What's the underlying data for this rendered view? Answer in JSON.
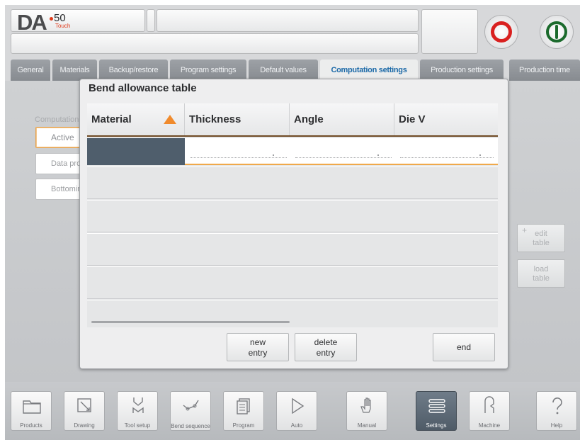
{
  "header": {
    "logo_text": "DA",
    "logo_model": "50",
    "logo_sub": "Touch"
  },
  "tabs": [
    {
      "label": "General"
    },
    {
      "label": "Materials"
    },
    {
      "label": "Backup/restore"
    },
    {
      "label": "Program settings"
    },
    {
      "label": "Default values"
    },
    {
      "label": "Computation settings",
      "active": true
    },
    {
      "label": "Production settings"
    },
    {
      "label": "Production time"
    }
  ],
  "panel": {
    "section_label": "Computation",
    "side_buttons": [
      {
        "label": "Active",
        "active": true
      },
      {
        "label": "Data protection"
      },
      {
        "label": "Bottoming"
      }
    ],
    "right_buttons": {
      "edit_plus": "+",
      "edit_label": "edit table",
      "load_label": "load table"
    }
  },
  "dialog": {
    "title": "Bend allowance table",
    "columns": [
      "Material",
      "Thickness",
      "Angle",
      "Die V"
    ],
    "sort_column": "Material",
    "rows": [],
    "buttons": {
      "new_entry": "new entry",
      "delete_entry": "delete entry",
      "end": "end"
    }
  },
  "bottom_nav": [
    {
      "label": "Products",
      "icon": "folder-icon"
    },
    {
      "label": "Drawing",
      "icon": "pencil-icon"
    },
    {
      "label": "Tool setup",
      "icon": "tool-icon"
    },
    {
      "label": "Bend sequence",
      "icon": "bend-sequence-icon"
    },
    {
      "label": "Program",
      "icon": "program-icon"
    },
    {
      "label": "Auto",
      "icon": "play-icon"
    },
    {
      "label": "Manual",
      "icon": "hand-icon"
    },
    {
      "label": "Settings",
      "icon": "settings-icon",
      "active": true
    },
    {
      "label": "Machine",
      "icon": "machine-icon"
    },
    {
      "label": "Help",
      "icon": "help-icon"
    }
  ],
  "colors": {
    "active_tab_text": "#1d6aa8",
    "accent_orange": "#f08a2c",
    "stop_red": "#d9201f",
    "start_green": "#1b6a2c",
    "selected_cell": "#4f5e6c"
  }
}
